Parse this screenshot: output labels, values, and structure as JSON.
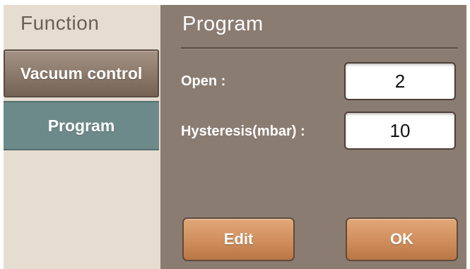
{
  "sidebar": {
    "title": "Function",
    "items": [
      {
        "label": "Vacuum control",
        "selected": false
      },
      {
        "label": "Program",
        "selected": true
      }
    ]
  },
  "main": {
    "title": "Program",
    "fields": [
      {
        "label": "Open :",
        "value": "2"
      },
      {
        "label": "Hysteresis(mbar) :",
        "value": "10"
      }
    ],
    "buttons": {
      "edit_label": "Edit",
      "ok_label": "OK"
    }
  },
  "colors": {
    "sidebar_bg": "#e6ddd0",
    "main_bg": "#8b7c72",
    "selected_item_bg": "#6c8a89",
    "action_button": "#cf8e5c"
  }
}
